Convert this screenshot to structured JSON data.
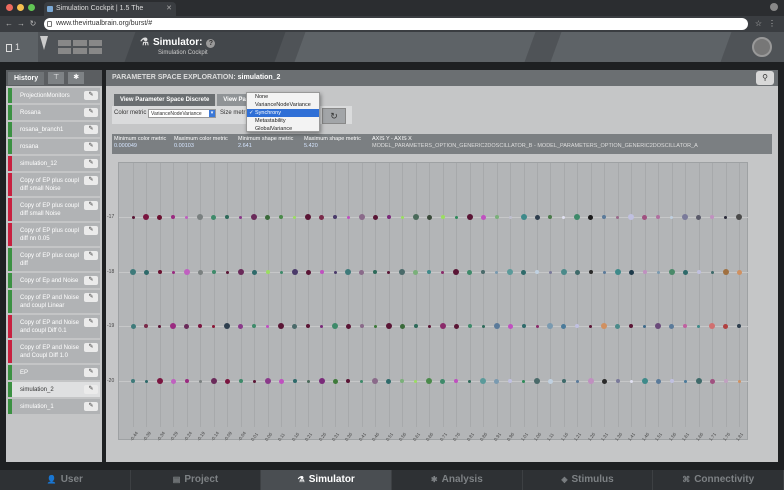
{
  "browser": {
    "tab_title": "Simulation Cockpit | 1.5 The",
    "url": "www.thevirtualbrain.org/burst/#"
  },
  "header": {
    "project_count": "1",
    "title": "Simulator:",
    "subtitle": "Simulation Cockpit"
  },
  "history": {
    "tab_label": "History",
    "items": [
      {
        "label": "ProjectionMonitors",
        "status": "green"
      },
      {
        "label": "Rosana",
        "status": "green"
      },
      {
        "label": "rosana_branch1",
        "status": "green"
      },
      {
        "label": "rosana",
        "status": "green"
      },
      {
        "label": "simulation_12",
        "status": "red"
      },
      {
        "label": "Copy of EP plus coupl diff small Noise",
        "status": "red"
      },
      {
        "label": "Copy of EP plus coupl diff small Noise",
        "status": "red"
      },
      {
        "label": "Copy of EP plus coupl diff nn 0.05",
        "status": "red"
      },
      {
        "label": "Copy of EP plus coupl diff",
        "status": "green"
      },
      {
        "label": "Copy of Ep and Noise",
        "status": "green"
      },
      {
        "label": "Copy of EP and Noise and coupl Linear",
        "status": "green"
      },
      {
        "label": "Copy of EP and Noise and coupl Diff 0.1",
        "status": "red"
      },
      {
        "label": "Copy of EP and Noise and Coupl Diff 1.0",
        "status": "red"
      },
      {
        "label": "EP",
        "status": "green"
      },
      {
        "label": "simulation_2",
        "status": "green",
        "active": true
      },
      {
        "label": "simulation_1",
        "status": "green"
      }
    ]
  },
  "main": {
    "section_title": "PARAMETER SPACE EXPLORATION:",
    "simulation_name": "simulation_2",
    "tabs": [
      "View Parameter Space Discrete",
      "View Par"
    ],
    "color_metric_label": "Color metric",
    "color_metric_value": "VarianceNodeVariance",
    "size_metric_label": "Size metr",
    "dropdown_options": [
      "None",
      "VarianceNodeVariance",
      "Synchrony",
      "Metastability",
      "GlobalVariance"
    ],
    "dropdown_selected": "Synchrony",
    "metrics": {
      "min_color_label": "Minimum color metric",
      "min_color_value": "0.000049",
      "max_color_label": "Maximum color metric",
      "max_color_value": "0.00103",
      "min_shape_label": "Minimum shape metric",
      "min_shape_value": "2.641",
      "max_shape_label": "Maximum shape metric",
      "max_shape_value": "5.420",
      "axis_label": "AXIS Y - AXIS X",
      "axis_value": "MODEL_PARAMETERS_OPTION_GENERIC2DOSCILLATOR_B - MODEL_PARAMETERS_OPTION_GENERIC2DOSCILLATOR_A"
    }
  },
  "chart_data": {
    "type": "scatter",
    "y_categories": [
      "-17",
      "-18",
      "-19",
      "-20"
    ],
    "x_ticks": [
      "-0.44",
      "-0.39",
      "-0.34",
      "-0.29",
      "-0.24",
      "-0.19",
      "-0.14",
      "-0.09",
      "-0.04",
      "0.01",
      "0.06",
      "0.11",
      "0.16",
      "0.21",
      "0.26",
      "0.31",
      "0.36",
      "0.41",
      "0.46",
      "0.51",
      "0.56",
      "0.61",
      "0.66",
      "0.71",
      "0.76",
      "0.81",
      "0.86",
      "0.91",
      "0.96",
      "1.01",
      "1.06",
      "1.11",
      "1.16",
      "1.21",
      "1.26",
      "1.31",
      "1.36",
      "1.41",
      "1.46",
      "1.51",
      "1.56",
      "1.61",
      "1.66",
      "1.71",
      "1.76",
      "1.81"
    ],
    "rows": [
      {
        "y": "-17",
        "colors": [
          "#5a1535",
          "#7a1540",
          "#6a1030",
          "#9a2a80",
          "#c060c0",
          "#7a8080",
          "#3e8a6a",
          "#2e6a5a",
          "#8a3a8a",
          "#6a2a5a",
          "#3a6a3a",
          "#4a8a4a",
          "#9ade60",
          "#5a1535",
          "#7a2a4a",
          "#4a3a6a",
          "#c050c0",
          "#8a6a8a",
          "#5a1535",
          "#7a2a7a",
          "#9ade60",
          "#4a6a5a",
          "#3a4a3a",
          "#9ade60",
          "#2e8a5a",
          "#5a1535",
          "#c050c0",
          "#7ab07a",
          "#c0c0d0",
          "#3e8a8a",
          "#2e3e4e",
          "#4a7a4a",
          "#e0e0f0",
          "#3e8a6a",
          "#1a1a1a",
          "#5a7a9a",
          "#9a6a8a",
          "#c0c0e0",
          "#a05080",
          "#b070a0",
          "#c0d0e0",
          "#7a7a9a",
          "#5a5a6a",
          "#c090c0",
          "#2a2a3a",
          "#4a4a4a"
        ]
      },
      {
        "y": "-18",
        "colors": [
          "#3e7a7a",
          "#2e6a6a",
          "#6a1030",
          "#9a2a80",
          "#c060c0",
          "#7a8080",
          "#3e8a6a",
          "#5a1535",
          "#6a2a5a",
          "#2e6a6a",
          "#9ade60",
          "#3e8a6a",
          "#4a3a6a",
          "#5a1535",
          "#c050c0",
          "#4a3a6a",
          "#3e7a7a",
          "#8a6a8a",
          "#2e6a5a",
          "#5a1535",
          "#4a6a6a",
          "#7ab07a",
          "#3e8a8a",
          "#8a2a6a",
          "#5a1535",
          "#3e8a6a",
          "#4a6a6a",
          "#7a9ab0",
          "#5a9a9a",
          "#2e6a6a",
          "#c0d0e0",
          "#7a7a9a",
          "#4a8a8a",
          "#3e6a6a",
          "#2a2a2a",
          "#5a7a9a",
          "#3e8a8a",
          "#1e3a4a",
          "#c090c0",
          "#7a9ab0",
          "#4a8a6a",
          "#2e6a6a",
          "#c0c0e0",
          "#3e6a6a",
          "#a07040",
          "#d09060"
        ]
      },
      {
        "y": "-19",
        "colors": [
          "#3e7a7a",
          "#7a2a4a",
          "#5a1535",
          "#9a2a80",
          "#6a2a5a",
          "#7a1540",
          "#8a1535",
          "#2e3e4e",
          "#8a3a8a",
          "#3e8a6a",
          "#c050c0",
          "#5a1535",
          "#4a6a6a",
          "#5a1535",
          "#7a2a7a",
          "#3e8a6a",
          "#5a1535",
          "#8a6a8a",
          "#3e7a3a",
          "#5a1535",
          "#3a6a3a",
          "#2e6a5a",
          "#5a1535",
          "#8a2a6a",
          "#5a1535",
          "#3e8a6a",
          "#2e6a5a",
          "#5a7a9a",
          "#c050c0",
          "#2e6a6a",
          "#8a2a6a",
          "#7a9ab0",
          "#4a7a9a",
          "#c0c0e0",
          "#5a1535",
          "#d09060",
          "#4a8a8a",
          "#5a1535",
          "#3e6a8a",
          "#6a4a7a",
          "#5a7a9a",
          "#c060a0",
          "#3e8a8a",
          "#d07070",
          "#b04040",
          "#2e3e4e"
        ]
      },
      {
        "y": "-20",
        "colors": [
          "#3e7a7a",
          "#2e6a6a",
          "#7a1540",
          "#c060c0",
          "#9a2a80",
          "#7a8080",
          "#6a2a5a",
          "#7a1540",
          "#3e8a6a",
          "#5a1535",
          "#8a3a8a",
          "#c050c0",
          "#2e6a6a",
          "#4a6a5a",
          "#7a2a7a",
          "#3e7a3a",
          "#5a1535",
          "#3e8a6a",
          "#8a6a8a",
          "#2e6a6a",
          "#7ab07a",
          "#9ade60",
          "#4a8a4a",
          "#3e8a6a",
          "#c050c0",
          "#2e6a5a",
          "#5a9a9a",
          "#7a9ab0",
          "#c0c0e0",
          "#2e8a5a",
          "#4a6a6a",
          "#c0d0e0",
          "#3e6a6a",
          "#5a7a9a",
          "#c090c0",
          "#2a2a2a",
          "#7a7a9a",
          "#e0e0f0",
          "#3e8a8a",
          "#5a7a9a",
          "#c0c0e0",
          "#4a7a9a",
          "#3e6a6a",
          "#a05080",
          "#c0a0c0",
          "#d09060"
        ]
      }
    ]
  },
  "bottom_nav": [
    {
      "label": "User",
      "icon": "user-icon"
    },
    {
      "label": "Project",
      "icon": "project-icon"
    },
    {
      "label": "Simulator",
      "icon": "flask-icon",
      "active": true
    },
    {
      "label": "Analysis",
      "icon": "gear-icon"
    },
    {
      "label": "Stimulus",
      "icon": "stimulus-icon"
    },
    {
      "label": "Connectivity",
      "icon": "connectivity-icon"
    }
  ]
}
